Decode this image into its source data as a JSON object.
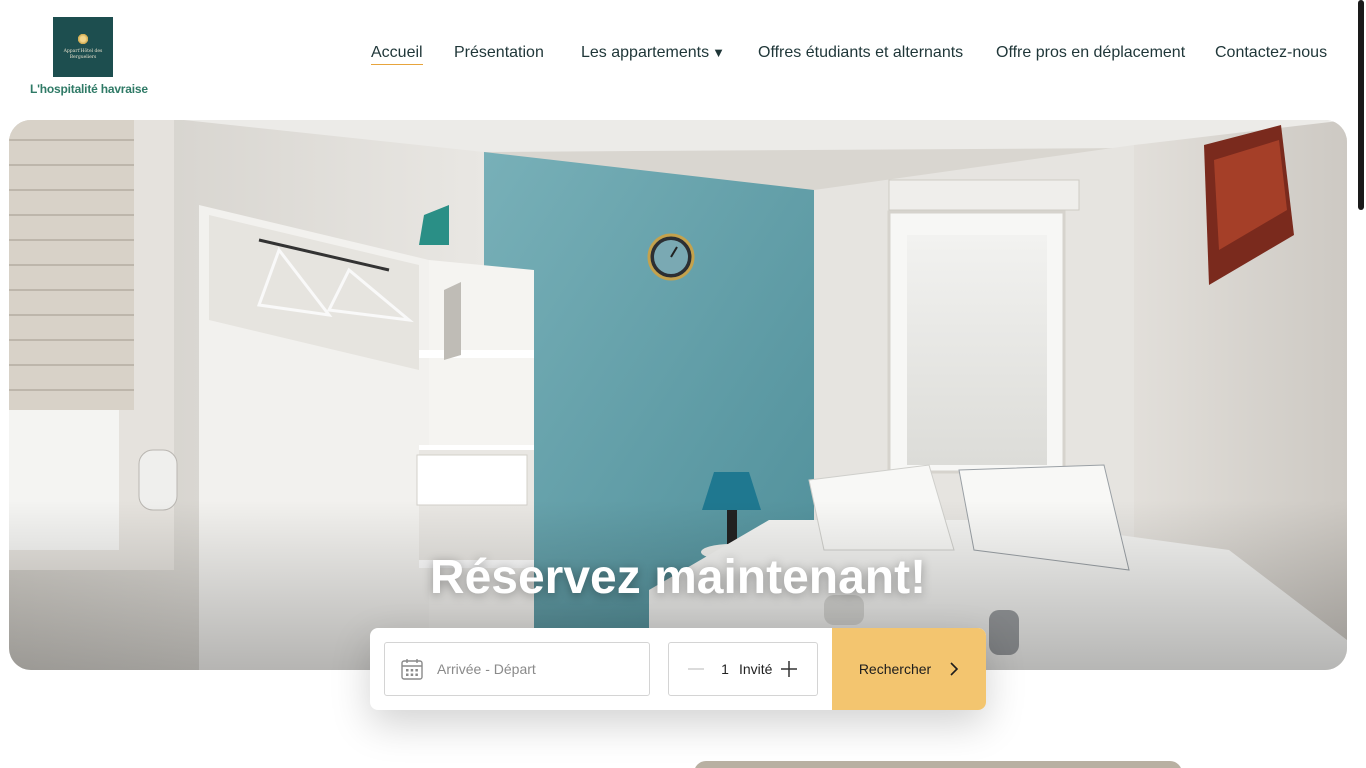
{
  "brand": {
    "logo_lines": [
      "Appart'Hôtel des",
      "Bergueliers"
    ],
    "tagline": "L'hospitalité havraise"
  },
  "nav": {
    "items": [
      {
        "label": "Accueil",
        "active": true
      },
      {
        "label": "Présentation"
      },
      {
        "label": "Les appartements",
        "has_dropdown": true,
        "dropdown_icon": "caret-down-icon"
      },
      {
        "label": "Offres étudiants et alternants"
      },
      {
        "label": "Offre pros en déplacement"
      },
      {
        "label": "Contactez-nous"
      }
    ],
    "active_color": "#e7a43c"
  },
  "hero": {
    "title": "Réservez maintenant!",
    "image": "bedroom-photo"
  },
  "booking": {
    "date_placeholder": "Arrivée - Départ",
    "guest_count": "1",
    "guest_label": "Invité",
    "search_label": "Rechercher",
    "accent_color": "#f3c56f",
    "icons": {
      "date": "calendar-icon",
      "decrement": "minus-icon",
      "increment": "plus-icon",
      "search": "chevron-right-icon"
    }
  }
}
